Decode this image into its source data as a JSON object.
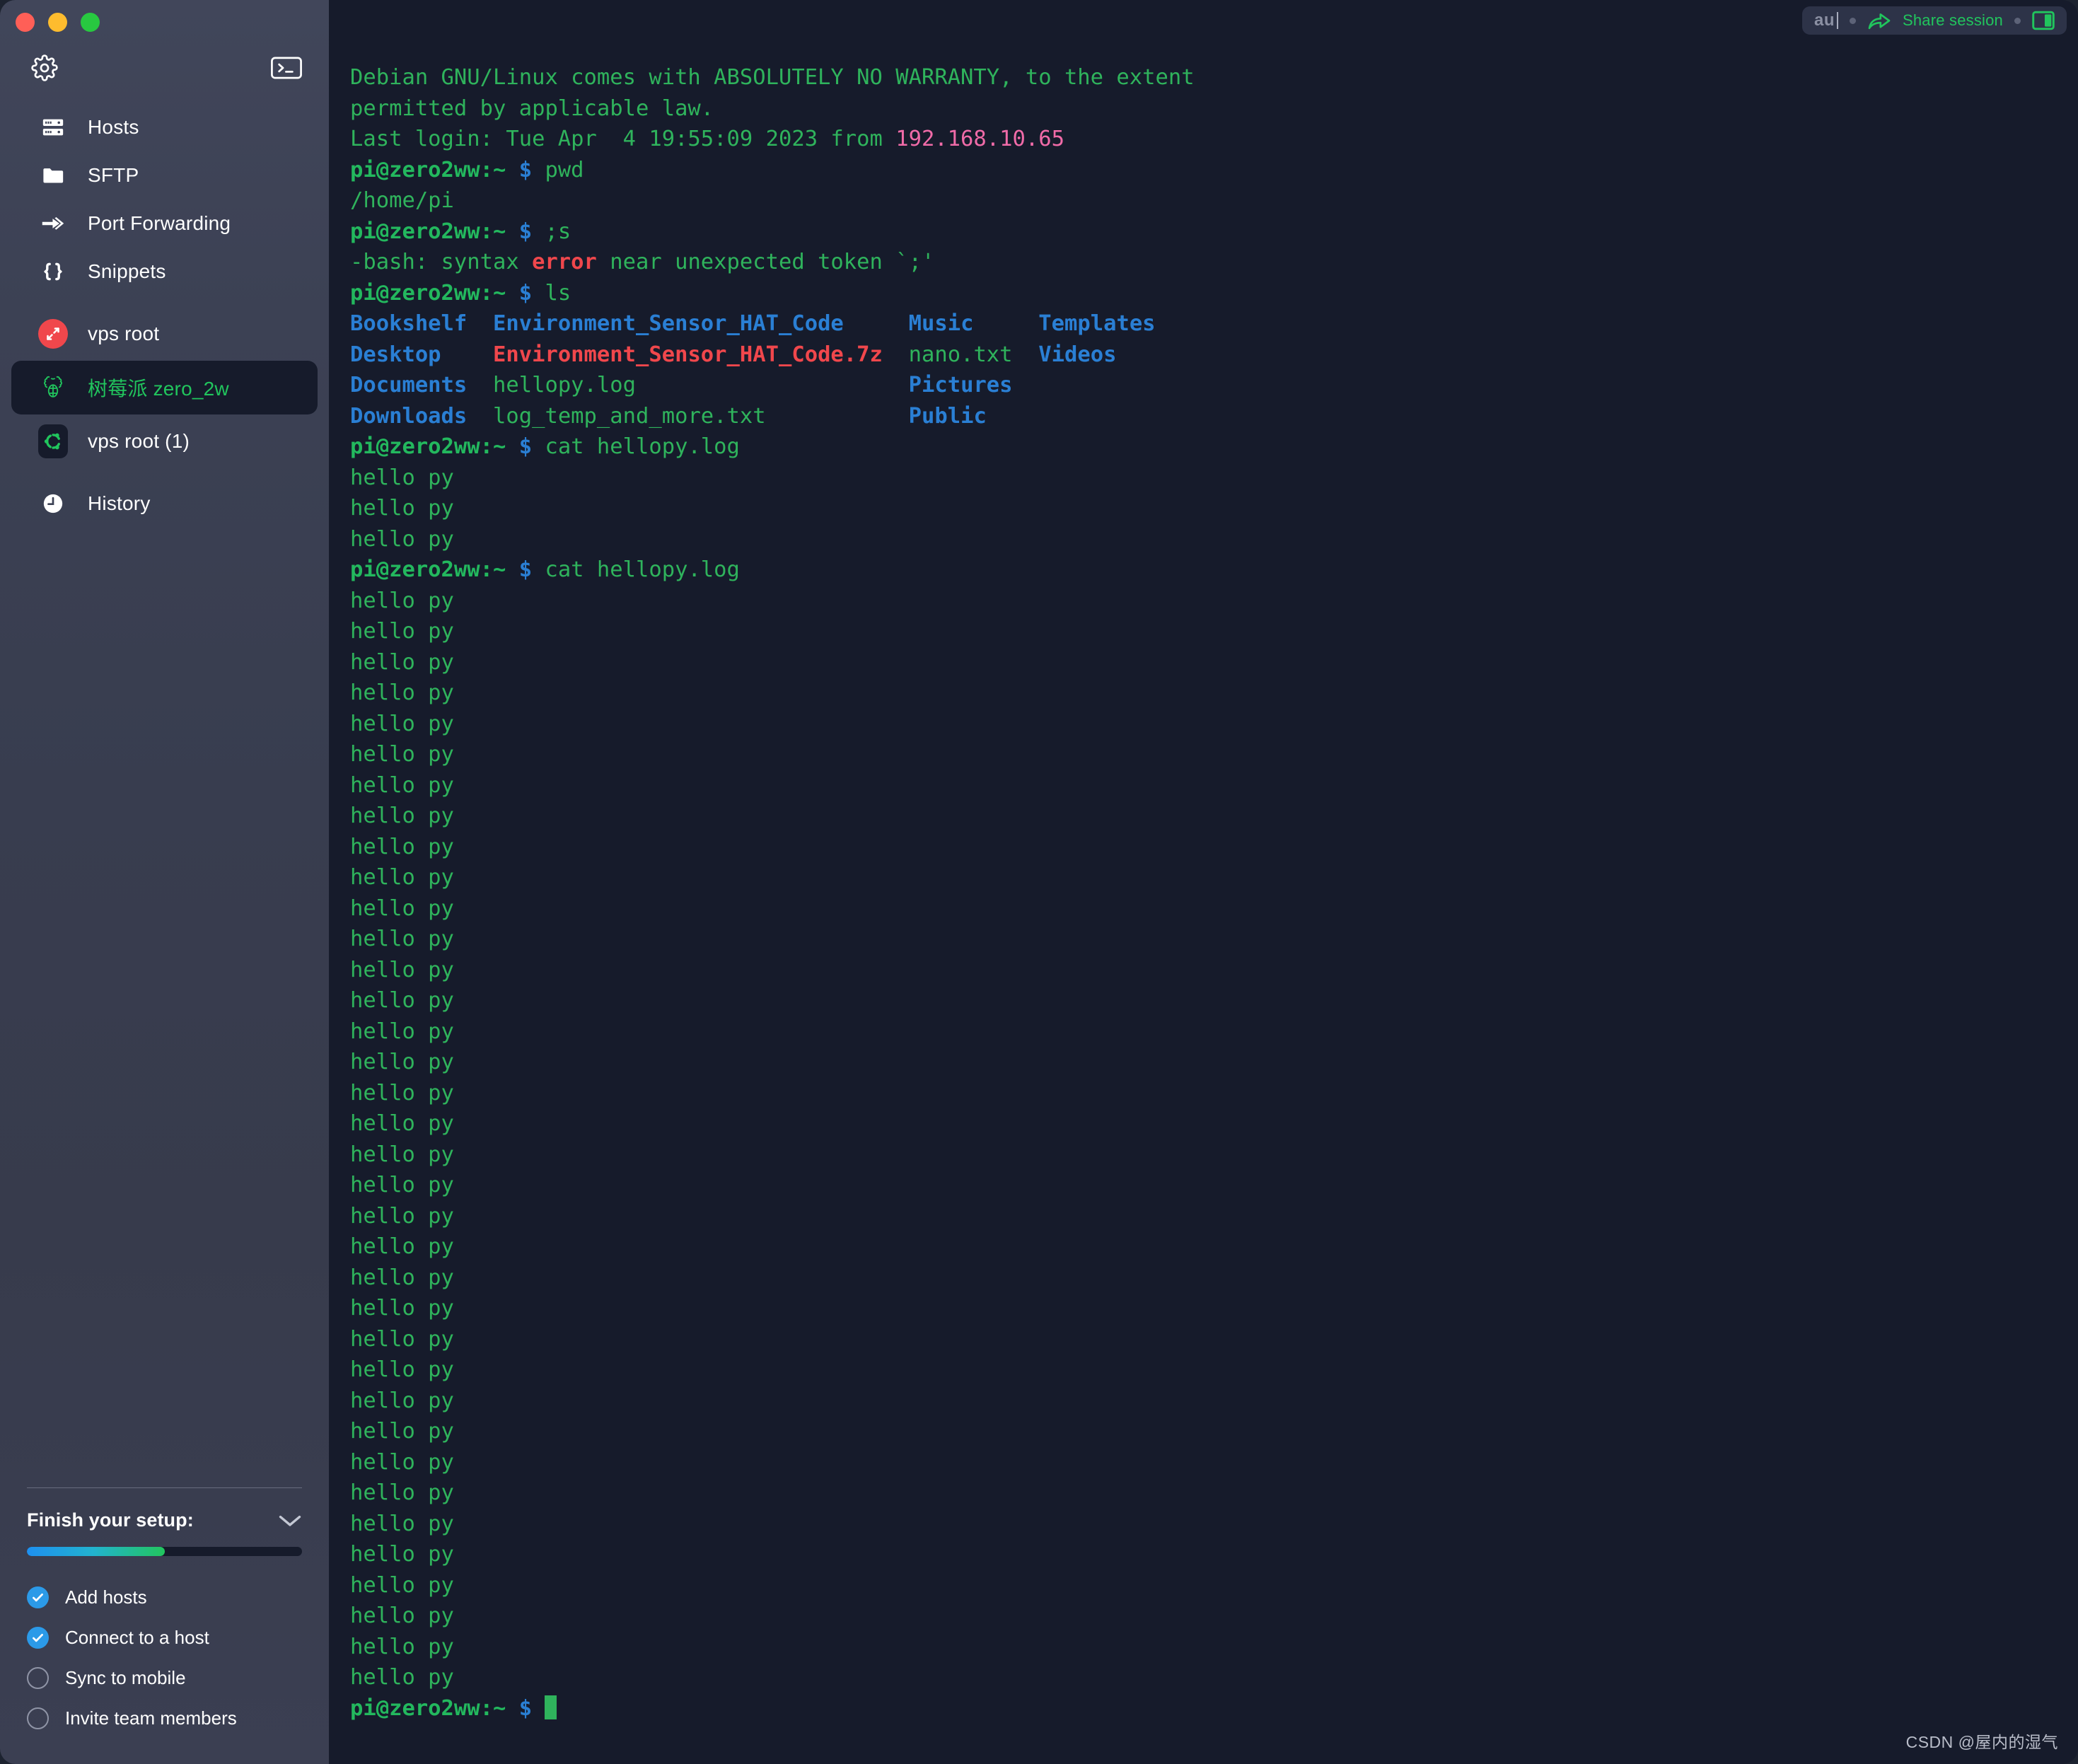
{
  "window": {
    "traffic_lights": [
      "close",
      "minimize",
      "maximize"
    ]
  },
  "sidebar": {
    "top": {
      "settings_icon": "gear-icon",
      "new_terminal_icon": "terminal-icon"
    },
    "nav_items": [
      {
        "label": "Hosts",
        "icon": "server-icon",
        "selected": false
      },
      {
        "label": "SFTP",
        "icon": "folder-icon",
        "selected": false
      },
      {
        "label": "Port Forwarding",
        "icon": "forward-arrow-icon",
        "selected": false
      },
      {
        "label": "Snippets",
        "icon": "braces-icon",
        "selected": false
      }
    ],
    "sessions": [
      {
        "label": "vps root",
        "icon": "resize-arrows-icon",
        "selected": false
      },
      {
        "label": "树莓派 zero_2w",
        "icon": "raspberry-pi-icon",
        "selected": true
      },
      {
        "label": "vps root (1)",
        "icon": "ubuntu-icon",
        "selected": false
      }
    ],
    "history": {
      "label": "History",
      "icon": "clock-icon"
    },
    "setup": {
      "title": "Finish your setup:",
      "collapse_icon": "chevron-down-icon",
      "progress_percent": 50,
      "tasks": [
        {
          "label": "Add hosts",
          "done": true
        },
        {
          "label": "Connect to a host",
          "done": true
        },
        {
          "label": "Sync to mobile",
          "done": false
        },
        {
          "label": "Invite team members",
          "done": false
        }
      ]
    }
  },
  "share_bar": {
    "input_value": "au",
    "input_placeholder": "au",
    "share_label": "Share session",
    "share_icon": "share-arrow-icon",
    "split_icon": "split-pane-icon"
  },
  "terminal": {
    "colors": {
      "background": "#161b2b",
      "green": "#2fb35c",
      "blue": "#2a7fd4",
      "pink": "#f06ba8",
      "red": "#f0474c"
    },
    "prompt": "pi@zero2ww:~",
    "prompt_symbol": "$",
    "lines": [
      {
        "segments": [
          {
            "t": "Debian GNU/Linux comes with ABSOLUTELY NO WARRANTY, to the extent",
            "c": "green"
          }
        ]
      },
      {
        "segments": [
          {
            "t": "permitted by applicable law.",
            "c": "green"
          }
        ]
      },
      {
        "segments": [
          {
            "t": "Last login: Tue Apr  4 19:55:09 2023 from ",
            "c": "green"
          },
          {
            "t": "192.168.10.65",
            "c": "pink"
          }
        ]
      },
      {
        "segments": [
          {
            "t": "pi@zero2ww:~",
            "c": "bgreen"
          },
          {
            "t": " $ ",
            "c": "blue"
          },
          {
            "t": "pwd",
            "c": "green"
          }
        ]
      },
      {
        "segments": [
          {
            "t": "/home/pi",
            "c": "green"
          }
        ]
      },
      {
        "segments": [
          {
            "t": "pi@zero2ww:~",
            "c": "bgreen"
          },
          {
            "t": " $ ",
            "c": "blue"
          },
          {
            "t": ";s",
            "c": "green"
          }
        ]
      },
      {
        "segments": [
          {
            "t": "-bash: syntax ",
            "c": "green"
          },
          {
            "t": "error",
            "c": "red"
          },
          {
            "t": " near unexpected token `;'",
            "c": "green"
          }
        ]
      },
      {
        "segments": [
          {
            "t": "pi@zero2ww:~",
            "c": "bgreen"
          },
          {
            "t": " $ ",
            "c": "blue"
          },
          {
            "t": "ls",
            "c": "green"
          }
        ]
      },
      {
        "segments": [
          {
            "t": "Bookshelf",
            "c": "dirblue"
          },
          {
            "t": "  ",
            "c": "green"
          },
          {
            "t": "Environment_Sensor_HAT_Code",
            "c": "dirblue"
          },
          {
            "t": "     ",
            "c": "green"
          },
          {
            "t": "Music",
            "c": "dirblue"
          },
          {
            "t": "     ",
            "c": "green"
          },
          {
            "t": "Templates",
            "c": "dirblue"
          }
        ]
      },
      {
        "segments": [
          {
            "t": "Desktop",
            "c": "dirblue"
          },
          {
            "t": "    ",
            "c": "green"
          },
          {
            "t": "Environment_Sensor_HAT_Code.7z",
            "c": "redbold"
          },
          {
            "t": "  ",
            "c": "green"
          },
          {
            "t": "nano.txt",
            "c": "green"
          },
          {
            "t": "  ",
            "c": "green"
          },
          {
            "t": "Videos",
            "c": "dirblue"
          }
        ]
      },
      {
        "segments": [
          {
            "t": "Documents",
            "c": "dirblue"
          },
          {
            "t": "  ",
            "c": "green"
          },
          {
            "t": "hellopy.log",
            "c": "green"
          },
          {
            "t": "                     ",
            "c": "green"
          },
          {
            "t": "Pictures",
            "c": "dirblue"
          }
        ]
      },
      {
        "segments": [
          {
            "t": "Downloads",
            "c": "dirblue"
          },
          {
            "t": "  ",
            "c": "green"
          },
          {
            "t": "log_temp_and_more.txt",
            "c": "green"
          },
          {
            "t": "           ",
            "c": "green"
          },
          {
            "t": "Public",
            "c": "dirblue"
          }
        ]
      },
      {
        "segments": [
          {
            "t": "pi@zero2ww:~",
            "c": "bgreen"
          },
          {
            "t": " $ ",
            "c": "blue"
          },
          {
            "t": "cat hellopy.log",
            "c": "green"
          }
        ]
      },
      {
        "segments": [
          {
            "t": "hello py",
            "c": "green"
          }
        ]
      },
      {
        "segments": [
          {
            "t": "hello py",
            "c": "green"
          }
        ]
      },
      {
        "segments": [
          {
            "t": "hello py",
            "c": "green"
          }
        ]
      },
      {
        "segments": [
          {
            "t": "pi@zero2ww:~",
            "c": "bgreen"
          },
          {
            "t": " $ ",
            "c": "blue"
          },
          {
            "t": "cat hellopy.log",
            "c": "green"
          }
        ]
      },
      {
        "segments": [
          {
            "t": "hello py",
            "c": "green"
          }
        ]
      },
      {
        "segments": [
          {
            "t": "hello py",
            "c": "green"
          }
        ]
      },
      {
        "segments": [
          {
            "t": "hello py",
            "c": "green"
          }
        ]
      },
      {
        "segments": [
          {
            "t": "hello py",
            "c": "green"
          }
        ]
      },
      {
        "segments": [
          {
            "t": "hello py",
            "c": "green"
          }
        ]
      },
      {
        "segments": [
          {
            "t": "hello py",
            "c": "green"
          }
        ]
      },
      {
        "segments": [
          {
            "t": "hello py",
            "c": "green"
          }
        ]
      },
      {
        "segments": [
          {
            "t": "hello py",
            "c": "green"
          }
        ]
      },
      {
        "segments": [
          {
            "t": "hello py",
            "c": "green"
          }
        ]
      },
      {
        "segments": [
          {
            "t": "hello py",
            "c": "green"
          }
        ]
      },
      {
        "segments": [
          {
            "t": "hello py",
            "c": "green"
          }
        ]
      },
      {
        "segments": [
          {
            "t": "hello py",
            "c": "green"
          }
        ]
      },
      {
        "segments": [
          {
            "t": "hello py",
            "c": "green"
          }
        ]
      },
      {
        "segments": [
          {
            "t": "hello py",
            "c": "green"
          }
        ]
      },
      {
        "segments": [
          {
            "t": "hello py",
            "c": "green"
          }
        ]
      },
      {
        "segments": [
          {
            "t": "hello py",
            "c": "green"
          }
        ]
      },
      {
        "segments": [
          {
            "t": "hello py",
            "c": "green"
          }
        ]
      },
      {
        "segments": [
          {
            "t": "hello py",
            "c": "green"
          }
        ]
      },
      {
        "segments": [
          {
            "t": "hello py",
            "c": "green"
          }
        ]
      },
      {
        "segments": [
          {
            "t": "hello py",
            "c": "green"
          }
        ]
      },
      {
        "segments": [
          {
            "t": "hello py",
            "c": "green"
          }
        ]
      },
      {
        "segments": [
          {
            "t": "hello py",
            "c": "green"
          }
        ]
      },
      {
        "segments": [
          {
            "t": "hello py",
            "c": "green"
          }
        ]
      },
      {
        "segments": [
          {
            "t": "hello py",
            "c": "green"
          }
        ]
      },
      {
        "segments": [
          {
            "t": "hello py",
            "c": "green"
          }
        ]
      },
      {
        "segments": [
          {
            "t": "hello py",
            "c": "green"
          }
        ]
      },
      {
        "segments": [
          {
            "t": "hello py",
            "c": "green"
          }
        ]
      },
      {
        "segments": [
          {
            "t": "hello py",
            "c": "green"
          }
        ]
      },
      {
        "segments": [
          {
            "t": "hello py",
            "c": "green"
          }
        ]
      },
      {
        "segments": [
          {
            "t": "hello py",
            "c": "green"
          }
        ]
      },
      {
        "segments": [
          {
            "t": "hello py",
            "c": "green"
          }
        ]
      },
      {
        "segments": [
          {
            "t": "hello py",
            "c": "green"
          }
        ]
      },
      {
        "segments": [
          {
            "t": "hello py",
            "c": "green"
          }
        ]
      },
      {
        "segments": [
          {
            "t": "hello py",
            "c": "green"
          }
        ]
      },
      {
        "segments": [
          {
            "t": "hello py",
            "c": "green"
          }
        ]
      },
      {
        "segments": [
          {
            "t": "hello py",
            "c": "green"
          }
        ]
      },
      {
        "segments": [
          {
            "t": "pi@zero2ww:~",
            "c": "bgreen"
          },
          {
            "t": " $ ",
            "c": "blue"
          },
          {
            "t": "",
            "c": "green",
            "cursor": true
          }
        ]
      }
    ]
  },
  "watermark": "CSDN @屋内的湿气"
}
